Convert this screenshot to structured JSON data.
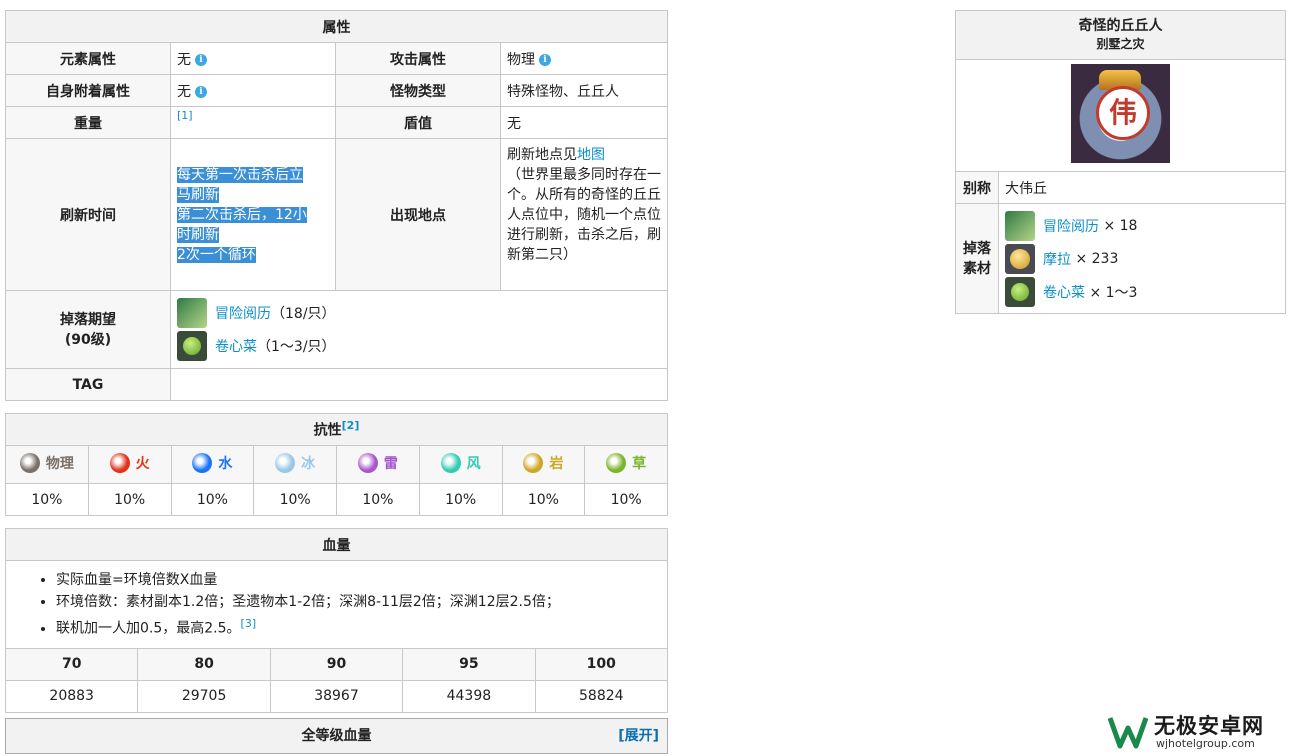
{
  "attributes": {
    "header": "属性",
    "element_label": "元素属性",
    "element_value": "无",
    "attack_label": "攻击属性",
    "attack_value": "物理",
    "self_attach_label": "自身附着属性",
    "self_attach_value": "无",
    "monster_type_label": "怪物类型",
    "monster_type_value": "特殊怪物、丘丘人",
    "weight_label": "重量",
    "weight_ref": "[1]",
    "shield_label": "盾值",
    "shield_value": "无",
    "refresh_label": "刷新时间",
    "refresh_lines": [
      "每天第一次击杀后立",
      "马刷新",
      "第二次击杀后，12小",
      "时刷新",
      "2次一个循环"
    ],
    "location_label": "出现地点",
    "location_prefix": "刷新地点见",
    "location_link": "地图",
    "location_text": "（世界里最多同时存在一个。从所有的奇怪的丘丘人点位中，随机一个点位进行刷新，击杀之后，刷新第二只）",
    "drop_label_1": "掉落期望",
    "drop_label_2": "(90级)",
    "drops": [
      {
        "name": "冒险阅历",
        "qty": "（18/只）",
        "icon": "adventure-exp-icon"
      },
      {
        "name": "卷心菜",
        "qty": "（1～3/只）",
        "icon": "cabbage-icon"
      }
    ],
    "tag_label": "TAG"
  },
  "resistance": {
    "header": "抗性",
    "ref": "[2]",
    "elements": [
      {
        "name": "物理",
        "value": "10%",
        "color": "#7a7068"
      },
      {
        "name": "火",
        "value": "10%",
        "color": "#e2311d"
      },
      {
        "name": "水",
        "value": "10%",
        "color": "#1c72fd"
      },
      {
        "name": "冰",
        "value": "10%",
        "color": "#98c8e8"
      },
      {
        "name": "雷",
        "value": "10%",
        "color": "#a757cb"
      },
      {
        "name": "风",
        "value": "10%",
        "color": "#33ccb3"
      },
      {
        "name": "岩",
        "value": "10%",
        "color": "#cfa726"
      },
      {
        "name": "草",
        "value": "10%",
        "color": "#7bb42d"
      }
    ]
  },
  "hp": {
    "header": "血量",
    "notes": [
      "实际血量=环境倍数X血量",
      "环境倍数：素材副本1.2倍；圣遗物本1-2倍；深渊8-11层2倍；深渊12层2.5倍；",
      "联机加一人加0.5，最高2.5。"
    ],
    "note_ref": "[3]",
    "levels": [
      "70",
      "80",
      "90",
      "95",
      "100"
    ],
    "values": [
      "20883",
      "29705",
      "38967",
      "44398",
      "58824"
    ]
  },
  "all_levels": {
    "header": "全等级血量",
    "toggle": "[展开]"
  },
  "infobox": {
    "title": "奇怪的丘丘人",
    "subtitle": "别墅之灾",
    "portrait_char": "伟",
    "alias_label": "别称",
    "alias_value": "大伟丘",
    "drop_label_1": "掉落",
    "drop_label_2": "素材",
    "drops": [
      {
        "name": "冒险阅历",
        "qty": "× 18",
        "icon": "adventure-exp-icon"
      },
      {
        "name": "摩拉",
        "qty": "× 233",
        "icon": "mora-icon"
      },
      {
        "name": "卷心菜",
        "qty": "× 1～3",
        "icon": "cabbage-icon"
      }
    ]
  },
  "watermark": {
    "name": "无极安卓网",
    "url": "wjhotelgroup.com"
  }
}
